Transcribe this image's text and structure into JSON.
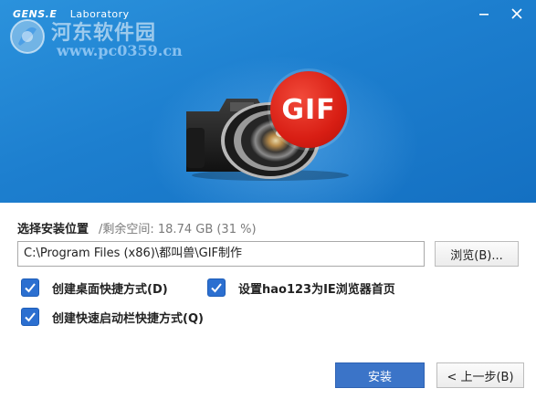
{
  "header": {
    "brand_name": "GENS.E",
    "brand_lab": "Laboratory"
  },
  "watermark": {
    "text_cn": "河东软件园",
    "url": "www.pc0359.cn"
  },
  "banner": {
    "badge_text": "GIF"
  },
  "install": {
    "label": "选择安装位置",
    "space_info": "/剩余空间: 18.74 GB (31 %)",
    "path_value": "C:\\Program Files (x86)\\都叫兽\\GIF制作",
    "browse_label": "浏览(B)..."
  },
  "options": {
    "desktop_shortcut": "创建桌面快捷方式(D)",
    "homepage": "设置hao123为IE浏览器首页",
    "quicklaunch_shortcut": "创建快速启动栏快捷方式(Q)"
  },
  "buttons": {
    "install_label": "安装",
    "back_label": "< 上一步(B)"
  },
  "colors": {
    "banner": "#1d7fcf",
    "accent": "#3b74c8",
    "badge": "#d81e14"
  }
}
